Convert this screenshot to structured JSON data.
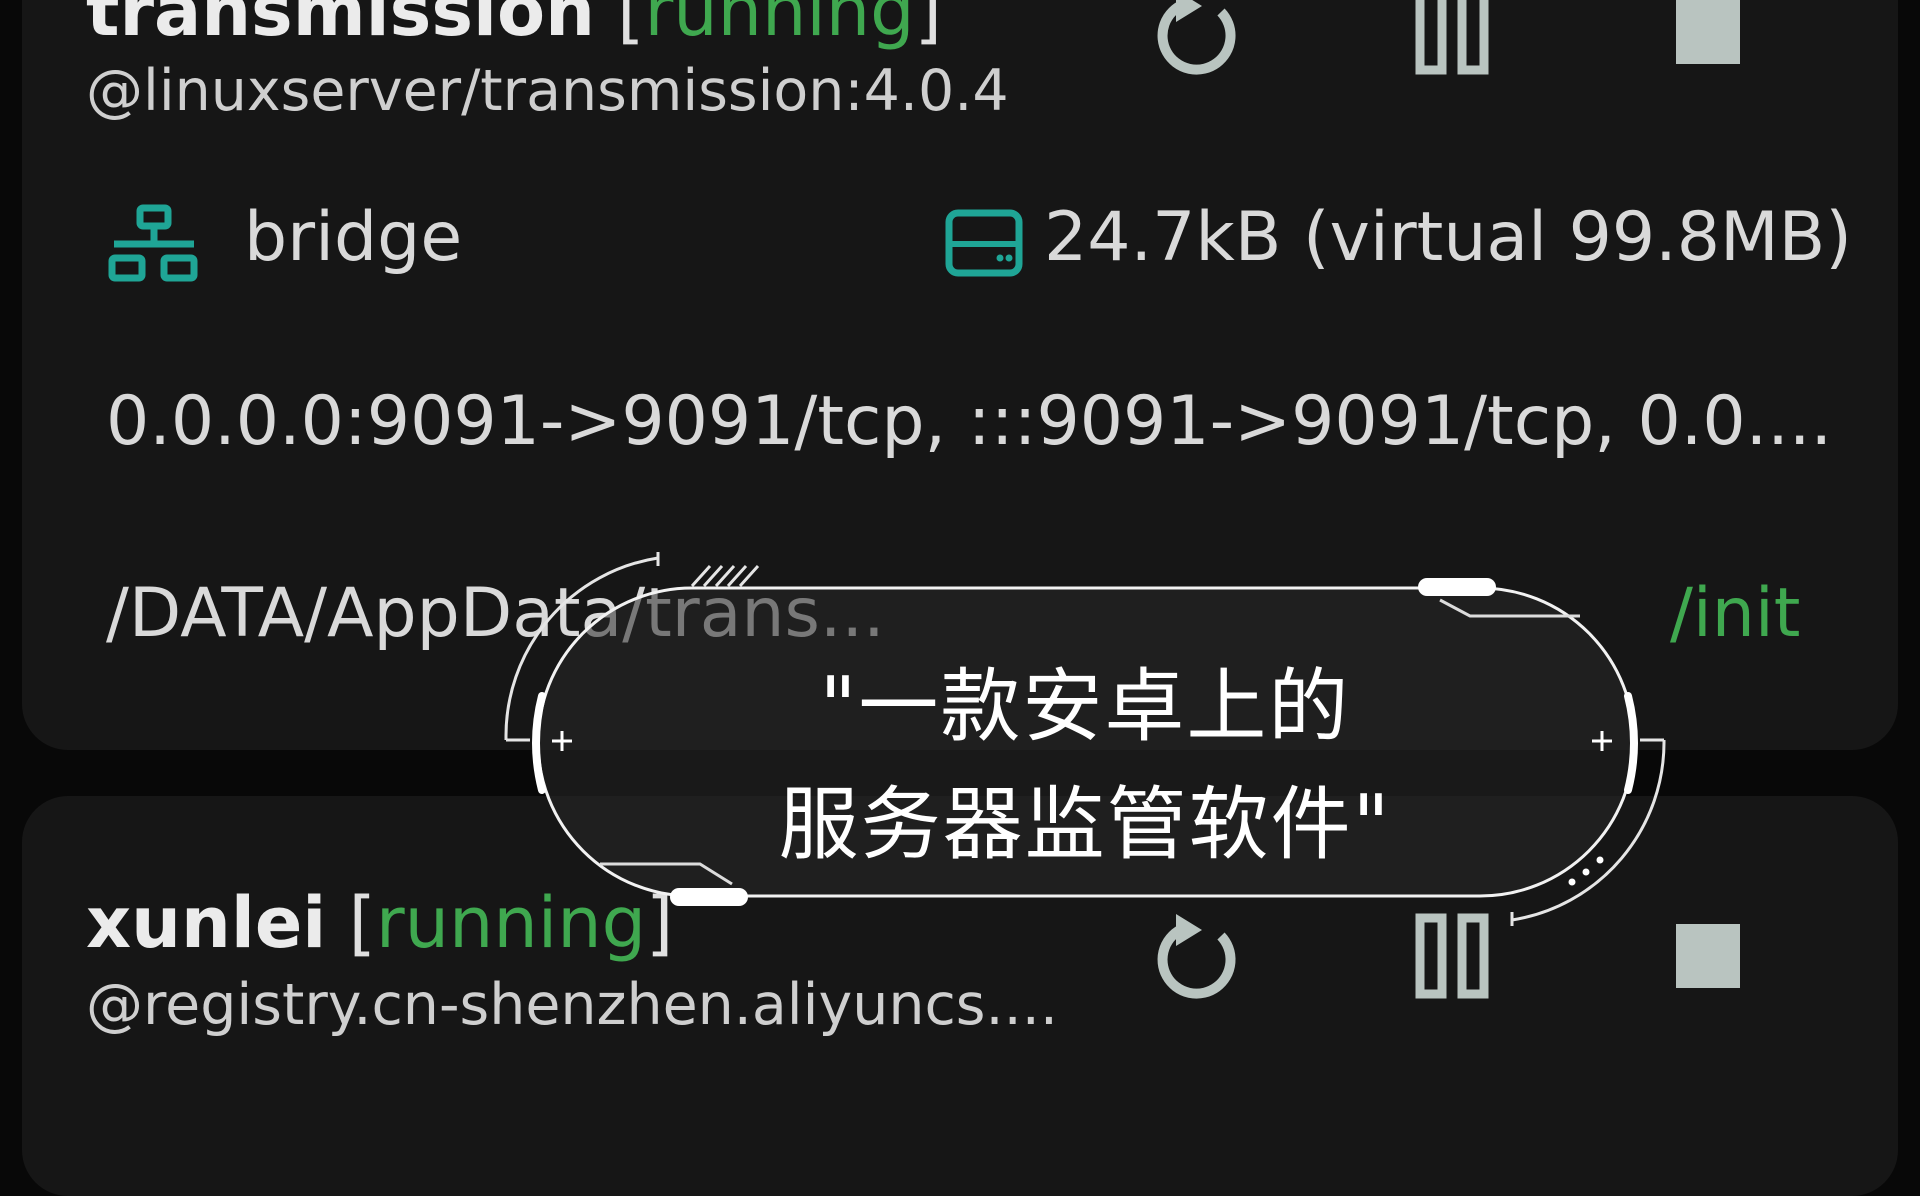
{
  "containers": [
    {
      "name": "transmission",
      "status": "running",
      "image": "@linuxserver/transmission:4.0.4",
      "network": "bridge",
      "size": "24.7kB (virtual 99.8MB)",
      "ports": "0.0.0.0:9091->9091/tcp, :::9091->9091/tcp, 0.0....",
      "volume": "/DATA/AppData/trans...",
      "command": "/init"
    },
    {
      "name": "xunlei",
      "status": "running",
      "image": "@registry.cn-shenzhen.aliyuncs...."
    }
  ],
  "brackets": {
    "open": "[",
    "close": "]"
  },
  "controls": {
    "restart_icon": "restart-icon",
    "pause_icon": "pause-icon",
    "stop_icon": "stop-icon"
  },
  "caption": {
    "line1": "\"一款安卓上的",
    "line2": "服务器监管软件\""
  },
  "colors": {
    "status_running": "#3fa84f",
    "accent_teal": "#1fa596",
    "card_bg": "#161616",
    "page_bg": "#080808",
    "control_gray": "#b9c4c0"
  }
}
